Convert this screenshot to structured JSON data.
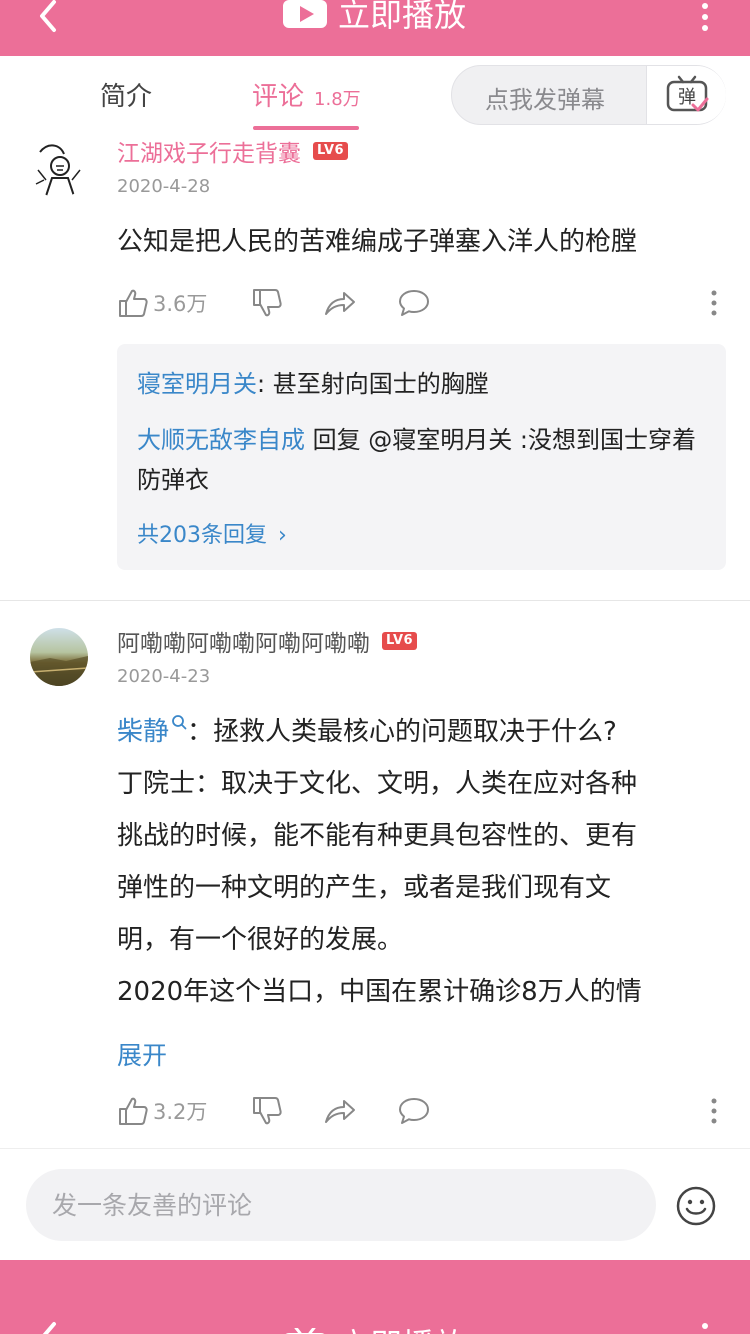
{
  "header": {
    "play_label": "立即播放"
  },
  "tabs": {
    "intro": "简介",
    "comments": "评论",
    "comments_count": "1.8万",
    "danmaku_placeholder": "点我发弹幕",
    "danmaku_button": "弹"
  },
  "comments": [
    {
      "username": "江湖戏子行走背囊",
      "level": "LV6",
      "date": "2020-4-28",
      "content": "公知是把人民的苦难编成子弹塞入洋人的枪膛",
      "likes": "3.6万",
      "replies": [
        {
          "name": "寝室明月关",
          "text": ": 甚至射向国士的胸膛"
        },
        {
          "name": "大顺无敌李自成",
          "text": " 回复 @寝室明月关 :没想到国士穿着防弹衣"
        }
      ],
      "replies_total": "共203条回复"
    },
    {
      "username": "阿嘞嘞阿嘞嘞阿嘞阿嘞嘞",
      "level": "LV6",
      "date": "2020-4-23",
      "mention": "柴静",
      "lines": [
        "：拯救人类最核心的问题取决于什么?",
        "丁院士：取决于文化、文明，人类在应对各种",
        "挑战的时候，能不能有种更具包容性的、更有",
        "弹性的一种文明的产生，或者是我们现有文",
        "明，有一个很好的发展。",
        "2020年这个当口，中国在累计确诊8万人的情"
      ],
      "expand": "展开",
      "likes": "3.2万"
    }
  ],
  "composer": {
    "placeholder": "发一条友善的评论"
  },
  "colors": {
    "brand_pink": "#ec6f98",
    "link_blue": "#3a87c9",
    "level_red": "#e64c4c"
  },
  "icons": [
    "back-arrow-icon",
    "tv-play-icon",
    "more-vertical-icon",
    "danmaku-icon",
    "like-icon",
    "dislike-icon",
    "share-icon",
    "comment-bubble-icon",
    "emoji-icon"
  ]
}
